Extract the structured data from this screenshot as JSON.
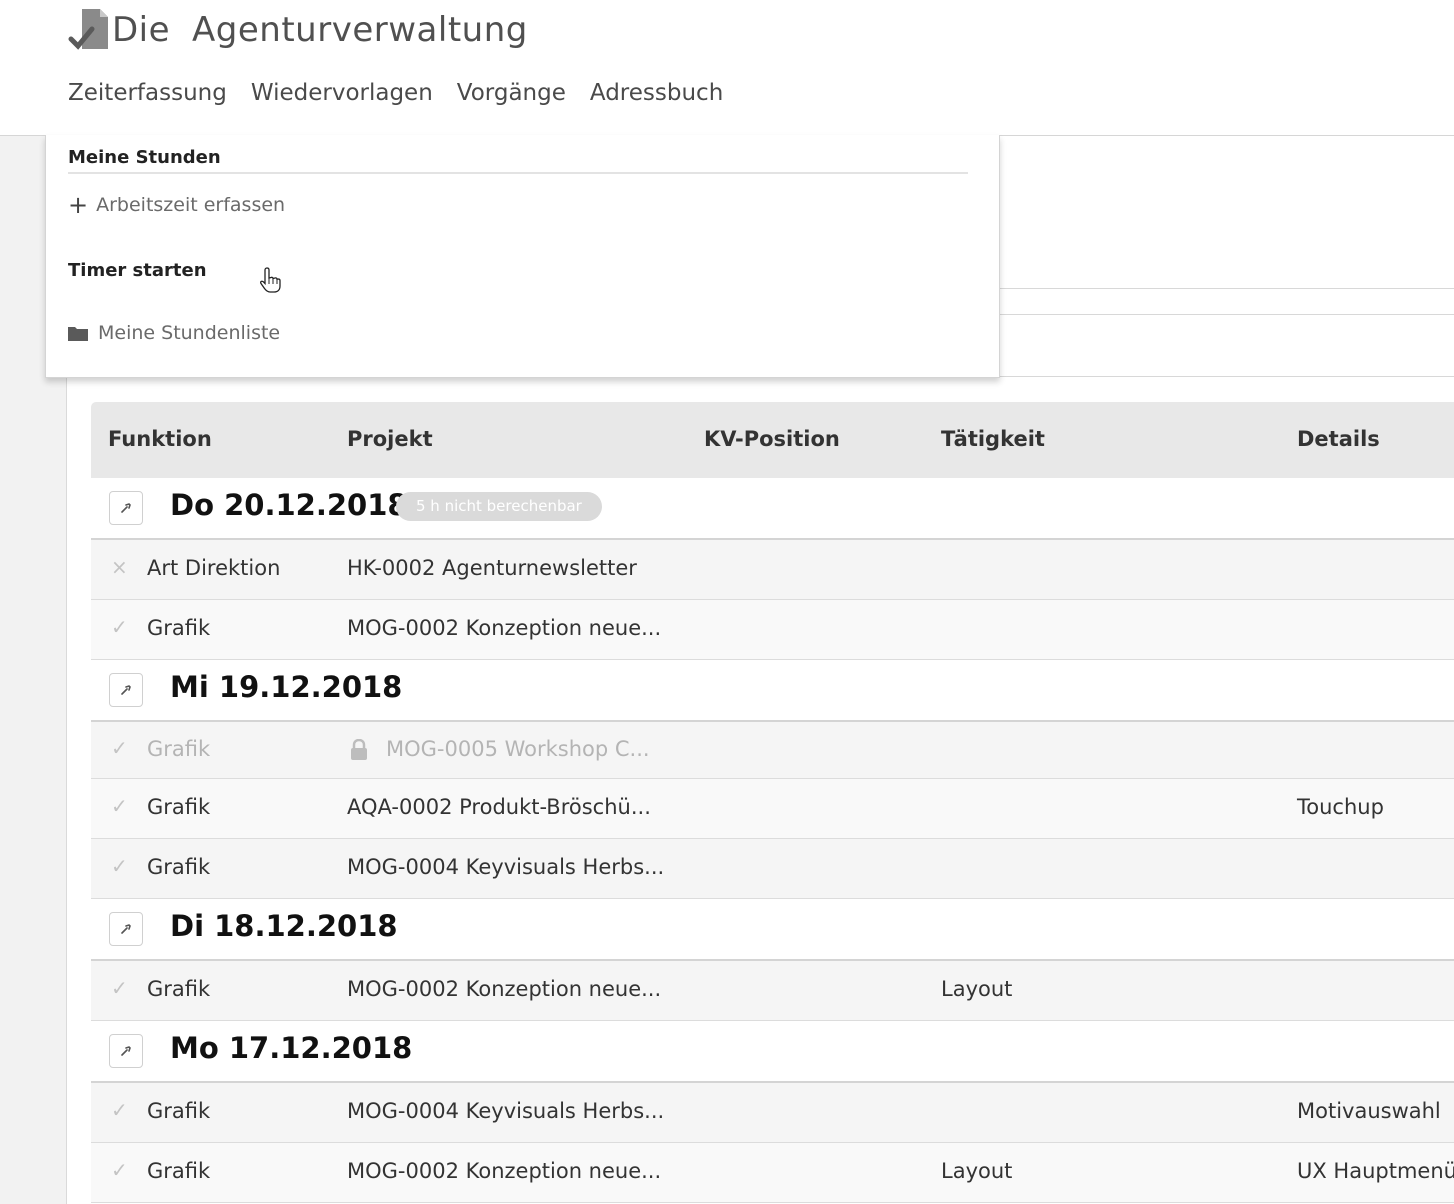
{
  "app": {
    "title_part1": "Die",
    "title_part2": "Agenturverwaltung"
  },
  "nav": [
    "Zeiterfassung",
    "Wiedervorlagen",
    "Vorgänge",
    "Adressbuch"
  ],
  "dropdown": {
    "section_title": "Meine Stunden",
    "add_label": "Arbeitszeit erfassen",
    "timer_label": "Timer starten",
    "list_label": "Meine Stundenliste"
  },
  "table": {
    "headers": [
      "Funktion",
      "Projekt",
      "KV-Position",
      "Tätigkeit",
      "Details"
    ],
    "days": [
      {
        "date": "Do 20.12.2018",
        "badge": "5 h nicht berechenbar",
        "entries": [
          {
            "status": "×",
            "funktion": "Art Direktion",
            "projekt": "HK-0002 Agenturnewsletter",
            "taetigkeit": "",
            "details": "",
            "locked": false
          },
          {
            "status": "✓",
            "funktion": "Grafik",
            "projekt": "MOG-0002 Konzeption neue...",
            "taetigkeit": "",
            "details": "",
            "locked": false
          }
        ]
      },
      {
        "date": "Mi 19.12.2018",
        "badge": "",
        "entries": [
          {
            "status": "✓",
            "funktion": "Grafik",
            "projekt": "MOG-0005 Workshop C...",
            "taetigkeit": "",
            "details": "",
            "locked": true
          },
          {
            "status": "✓",
            "funktion": "Grafik",
            "projekt": "AQA-0002 Produkt-Bröschü...",
            "taetigkeit": "",
            "details": "Touchup",
            "locked": false
          },
          {
            "status": "✓",
            "funktion": "Grafik",
            "projekt": "MOG-0004 Keyvisuals Herbs...",
            "taetigkeit": "",
            "details": "",
            "locked": false
          }
        ]
      },
      {
        "date": "Di 18.12.2018",
        "badge": "",
        "entries": [
          {
            "status": "✓",
            "funktion": "Grafik",
            "projekt": "MOG-0002 Konzeption neue...",
            "taetigkeit": "Layout",
            "details": "",
            "locked": false
          }
        ]
      },
      {
        "date": "Mo 17.12.2018",
        "badge": "",
        "entries": [
          {
            "status": "✓",
            "funktion": "Grafik",
            "projekt": "MOG-0004 Keyvisuals Herbs...",
            "taetigkeit": "",
            "details": "Motivauswahl",
            "locked": false
          },
          {
            "status": "✓",
            "funktion": "Grafik",
            "projekt": "MOG-0002 Konzeption neue...",
            "taetigkeit": "Layout",
            "details": "UX Hauptmenü",
            "locked": false
          }
        ]
      }
    ]
  },
  "icons": {
    "logo": "document-check-icon",
    "add": "plus-icon",
    "list": "folder-icon",
    "day_action": "wrench-icon",
    "locked": "lock-icon",
    "cursor": "hand-pointer-icon"
  },
  "colors": {
    "header_bg": "#e8e8e8",
    "badge_bg": "#dadada",
    "row_bg": "#f5f5f5",
    "muted_text": "#b4b4b4"
  }
}
